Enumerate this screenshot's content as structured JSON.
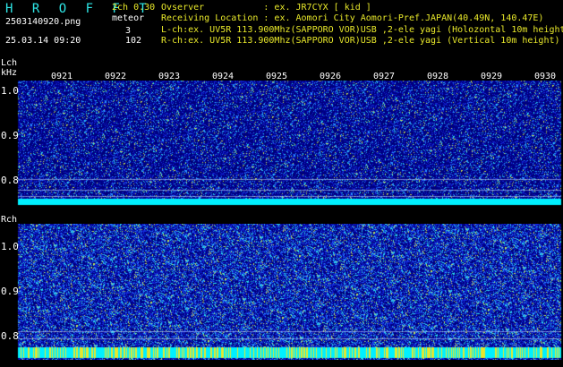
{
  "header": {
    "app_title": "H R O F F T",
    "version": "2ch 0.30",
    "mode_label": "meteor",
    "filename": "2503140920.png",
    "datetime": "25.03.14 09:20",
    "l_count": "3",
    "r_count": "102",
    "observer": "Ovserver           : ex. JR7CYX [ kid ]",
    "location": "Receiving Location : ex. Aomori City Aomori-Pref.JAPAN(40.49N, 140.47E)",
    "l_channel": "L-ch:ex. UV5R 113.900Mhz(SAPPORO VOR)USB ,2-ele yagi (Holozontal 10m height)",
    "r_channel": "R-ch:ex. UV5R 113.900Mhz(SAPPORO VOR)USB ,2-ele yagi (Vertical 10m height)"
  },
  "panels": {
    "lch_label": "Lch",
    "khz_label": "kHz",
    "rch_label": "Rch"
  },
  "axes": {
    "y_ticks": [
      "1.0",
      "0.9",
      "0.8"
    ],
    "x_ticks": [
      "0921",
      "0922",
      "0923",
      "0924",
      "0925",
      "0926",
      "0927",
      "0928",
      "0929",
      "0930"
    ]
  },
  "colors": {
    "background": "#000000",
    "waterfall_base": "#0a0a8c",
    "signal_cyan": "#00f0ff",
    "signal_yellow": "#e8e82a",
    "text_cyan": "#2ee6e6",
    "text_yellow": "#e8e82a"
  }
}
